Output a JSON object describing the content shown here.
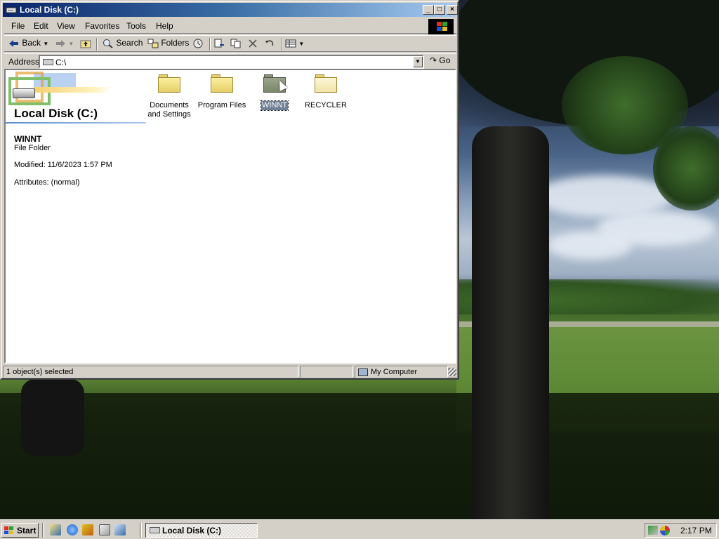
{
  "window": {
    "title": "Local Disk (C:)",
    "minimize_glyph": "_",
    "maximize_glyph": "□",
    "close_glyph": "×"
  },
  "menubar": {
    "items": [
      "File",
      "Edit",
      "View",
      "Favorites",
      "Tools",
      "Help"
    ]
  },
  "toolbar": {
    "back_label": "Back",
    "search_label": "Search",
    "folders_label": "Folders"
  },
  "addressbar": {
    "label": "Address",
    "value": "C:\\",
    "go_label": "Go"
  },
  "infopane": {
    "title": "Local Disk (C:)",
    "selected_name": "WINNT",
    "selected_type": "File Folder",
    "modified": "Modified: 11/6/2023 1:57 PM",
    "attributes": "Attributes: (normal)"
  },
  "folders": [
    {
      "name": "Documents and Settings",
      "line1": "Documents",
      "line2": "and Settings",
      "selected": false
    },
    {
      "name": "Program Files",
      "line1": "Program Files",
      "line2": "",
      "selected": false
    },
    {
      "name": "WINNT",
      "line1": "WINNT",
      "line2": "",
      "selected": true
    },
    {
      "name": "RECYCLER",
      "line1": "RECYCLER",
      "line2": "",
      "selected": false,
      "hidden_style": true
    }
  ],
  "statusbar": {
    "selection": "1 object(s) selected",
    "location": "My Computer"
  },
  "taskbar": {
    "start_label": "Start",
    "task_label": "Local Disk (C:)",
    "clock": "2:17 PM"
  }
}
